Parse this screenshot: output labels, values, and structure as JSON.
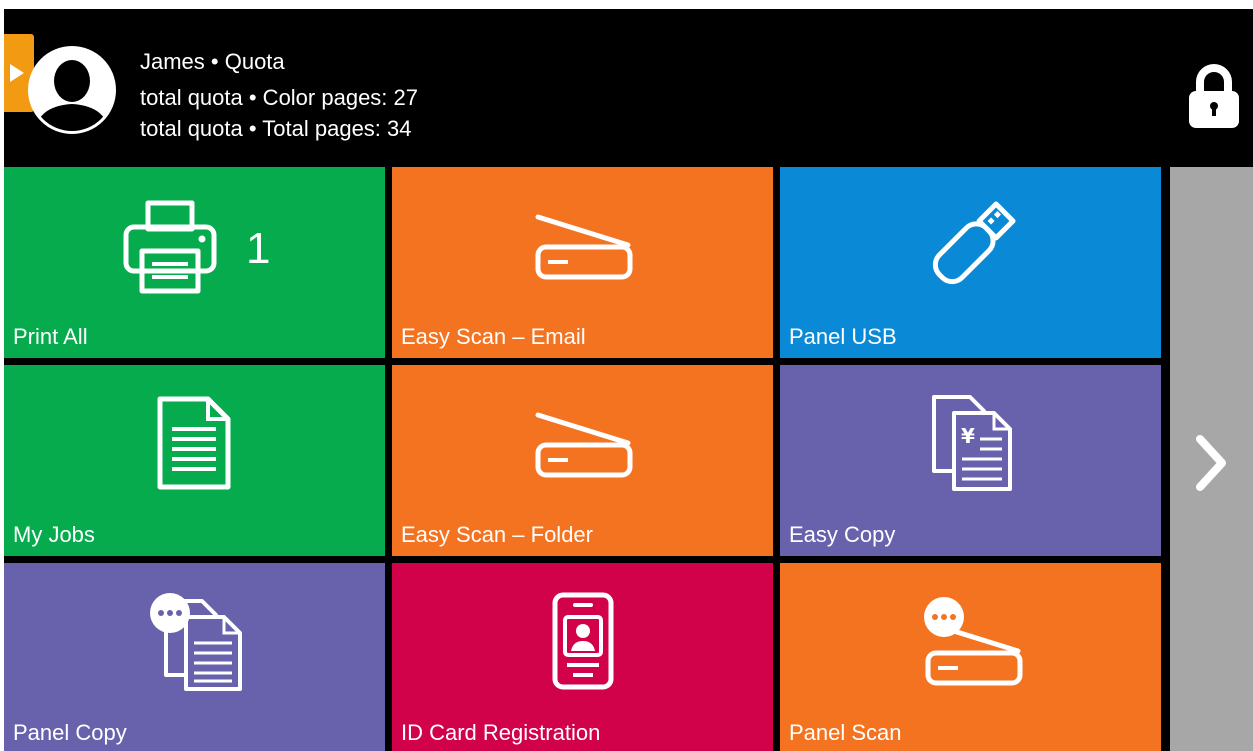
{
  "header": {
    "user_line": "James • Quota",
    "color_line": "total quota  • Color pages: 27",
    "total_line": "total quota  • Total pages: 34"
  },
  "tiles": [
    {
      "label": "Print All",
      "badge": "1",
      "color": "#06ab4e",
      "icon": "printer-icon"
    },
    {
      "label": "Easy Scan – Email",
      "color": "#f47321",
      "icon": "scanner-icon"
    },
    {
      "label": "Panel USB",
      "color": "#0a89d6",
      "icon": "usb-drive-icon"
    },
    {
      "label": "My Jobs",
      "color": "#06ab4e",
      "icon": "document-icon"
    },
    {
      "label": "Easy Scan – Folder",
      "color": "#f47321",
      "icon": "scanner-icon"
    },
    {
      "label": "Easy Copy",
      "color": "#6862ad",
      "icon": "copy-documents-icon"
    },
    {
      "label": "Panel Copy",
      "color": "#6862ad",
      "icon": "panel-copy-icon"
    },
    {
      "label": "ID Card Registration",
      "color": "#d1014a",
      "icon": "id-card-icon"
    },
    {
      "label": "Panel Scan",
      "color": "#f47321",
      "icon": "panel-scan-icon"
    }
  ],
  "colors": {
    "header_bg": "#000000",
    "side_tab": "#f29b12",
    "next_panel": "#a7a7a7"
  },
  "icons": {
    "side_tab": "expand-arrow-icon",
    "avatar": "user-avatar-icon",
    "lock": "lock-icon",
    "next": "chevron-right-icon"
  }
}
